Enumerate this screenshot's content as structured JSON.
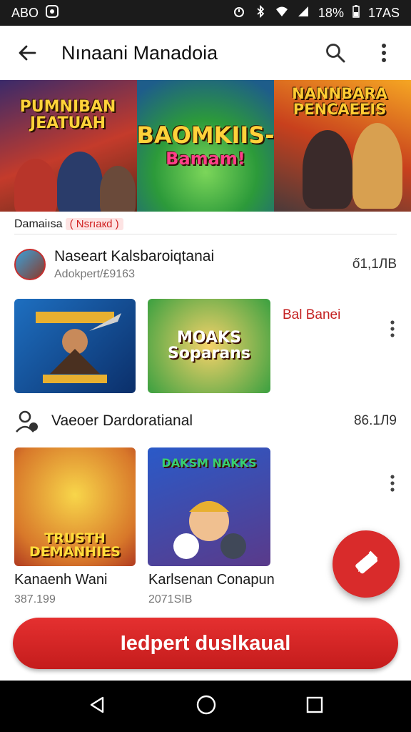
{
  "status_bar": {
    "left_text": "ABO",
    "battery": "18%",
    "time": "17AS"
  },
  "app_bar": {
    "title": "Nınaani Manadoia",
    "back_icon": "arrow-left-icon",
    "search_icon": "search-icon",
    "menu_icon": "more-vert-icon"
  },
  "banner": {
    "panels": [
      {
        "title": "PUMNIBAN JEATUAH",
        "badge": ""
      },
      {
        "title": "BAOMKIIS-",
        "subtitle": "Bamam!"
      },
      {
        "title": "NANNBARA PENCAEEIS"
      }
    ]
  },
  "section": {
    "label": "Damaiısa",
    "tag": "( Nsrıaкd )"
  },
  "row1": {
    "title": "Naseart Kalsbaroiqtanai",
    "subtitle": "Adokpert/£9163",
    "count": "ő1,1ЛВ",
    "side_label": "Bal Banei",
    "thumbs": [
      {
        "text": ""
      },
      {
        "text": "MOAKS Soparans"
      }
    ]
  },
  "row2": {
    "title": "Vaeoer Dardoratianal",
    "count": "86.1Л9",
    "thumbs": [
      {
        "text": "TRUSTH DEMANHIES",
        "caption": "Kanaenh Wani",
        "sub": "387.199"
      },
      {
        "text": "DAKSM NAKKS",
        "caption": "Karlsenan Conapun",
        "sub": "2071SIB"
      }
    ]
  },
  "primary_button": {
    "label": "Iedpert duslkaual"
  },
  "colors": {
    "accent": "#d92b2b",
    "status_bar": "#1b1b1b",
    "nav_bar": "#000000"
  }
}
